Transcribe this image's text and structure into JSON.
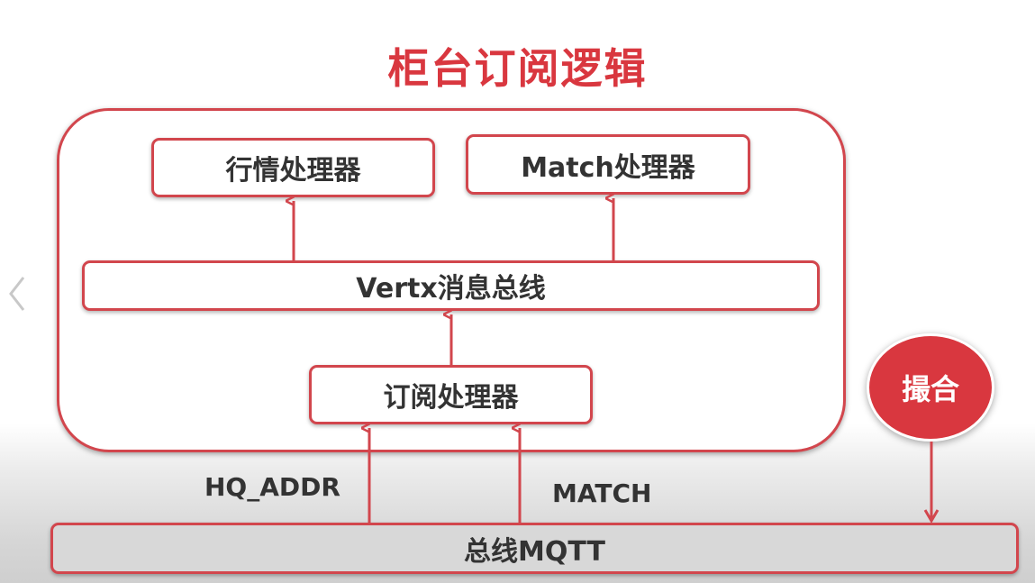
{
  "title": "柜台订阅逻辑",
  "nodes": {
    "hq_processor": "行情处理器",
    "match_processor": "Match处理器",
    "vertx_bus": "Vertx消息总线",
    "subscribe_processor": "订阅处理器",
    "mqtt_bus": "总线MQTT",
    "matching": "撮合"
  },
  "edge_labels": {
    "hq_addr": "HQ_ADDR",
    "match": "MATCH"
  },
  "colors": {
    "accent": "#d9373f",
    "border": "#d2464d",
    "text": "#333333"
  },
  "icons": {
    "nav": "chevron-left-icon"
  }
}
